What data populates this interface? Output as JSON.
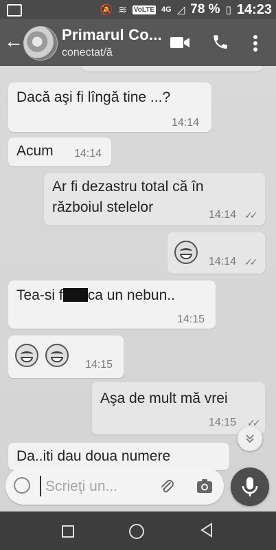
{
  "status_bar": {
    "volte": "VoLTE",
    "network": "4G",
    "battery_percent": "78 %",
    "time": "14:23"
  },
  "app_bar": {
    "contact_name": "Primarul Co...",
    "contact_status": "conectat/ă",
    "icons": [
      "back-arrow-icon",
      "avatar",
      "video-call-icon",
      "phone-icon",
      "more-icon"
    ]
  },
  "messages": [
    {
      "direction": "in",
      "text": "Dacă aşi fi lîngă tine ...?",
      "time": "14:14"
    },
    {
      "direction": "in",
      "text": "Acum",
      "time": "14:14"
    },
    {
      "direction": "out",
      "line1": "Ar fi dezastru total că în",
      "line2": "războiul stelelor",
      "time": "14:14",
      "status": "read"
    },
    {
      "direction": "out",
      "emoji": "grinning-squinting-face",
      "time": "14:14",
      "status": "read"
    },
    {
      "direction": "in",
      "text_before": "Tea-si f",
      "text_after": "ca un nebun..",
      "redacted": true,
      "time": "14:15"
    },
    {
      "direction": "in",
      "emoji": "grinning-squinting-face x2",
      "time": "14:15"
    },
    {
      "direction": "out",
      "text": "Aşa de mult mă vrei",
      "time": "14:15",
      "status": "read"
    },
    {
      "direction": "in",
      "text": "Da..iti dau doua numere"
    }
  ],
  "input": {
    "placeholder": "Scrieţi un..."
  },
  "colors": {
    "app_bar": "#575757",
    "status_bar": "#4a4a4a",
    "chat_background": "#d9d9d9",
    "bubble_in": "#f2f2f2",
    "bubble_out": "#e6e6e6",
    "nav_bar": "#3d3d3d"
  }
}
